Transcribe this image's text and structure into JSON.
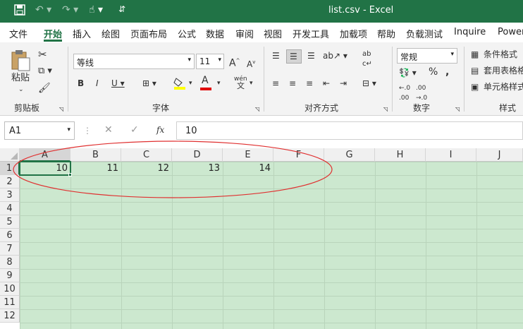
{
  "window": {
    "title": "list.csv - Excel"
  },
  "ribbon_tabs": [
    "文件",
    "开始",
    "插入",
    "绘图",
    "页面布局",
    "公式",
    "数据",
    "审阅",
    "视图",
    "开发工具",
    "加载项",
    "帮助",
    "负载测试",
    "Inquire",
    "Power"
  ],
  "clipboard": {
    "paste_label": "粘贴",
    "group_label": "剪贴板"
  },
  "font": {
    "name": "等线",
    "size": "11",
    "group_label": "字体",
    "wen_label": "wén",
    "wen_char": "文"
  },
  "alignment": {
    "group_label": "对齐方式"
  },
  "number": {
    "format": "常规",
    "group_label": "数字"
  },
  "styles": {
    "cond_format": "条件格式",
    "table_format": "套用表格格式",
    "cell_style": "单元格样式",
    "group_label": "样式"
  },
  "formula_bar": {
    "name_box": "A1",
    "fx_label": "fx",
    "value": "10"
  },
  "columns": [
    "A",
    "B",
    "C",
    "D",
    "E",
    "F",
    "G",
    "H",
    "I",
    "J"
  ],
  "rows": [
    "1",
    "2",
    "3",
    "4",
    "5",
    "6",
    "7",
    "8",
    "9",
    "10",
    "11",
    "12"
  ],
  "cells": [
    {
      "ref": "A1",
      "value": "10"
    },
    {
      "ref": "B1",
      "value": "11"
    },
    {
      "ref": "C1",
      "value": "12"
    },
    {
      "ref": "D1",
      "value": "13"
    },
    {
      "ref": "E1",
      "value": "14"
    }
  ],
  "colors": {
    "accent": "#217346",
    "sheet_bg": "#cce8cf",
    "annotation": "#e03030"
  }
}
